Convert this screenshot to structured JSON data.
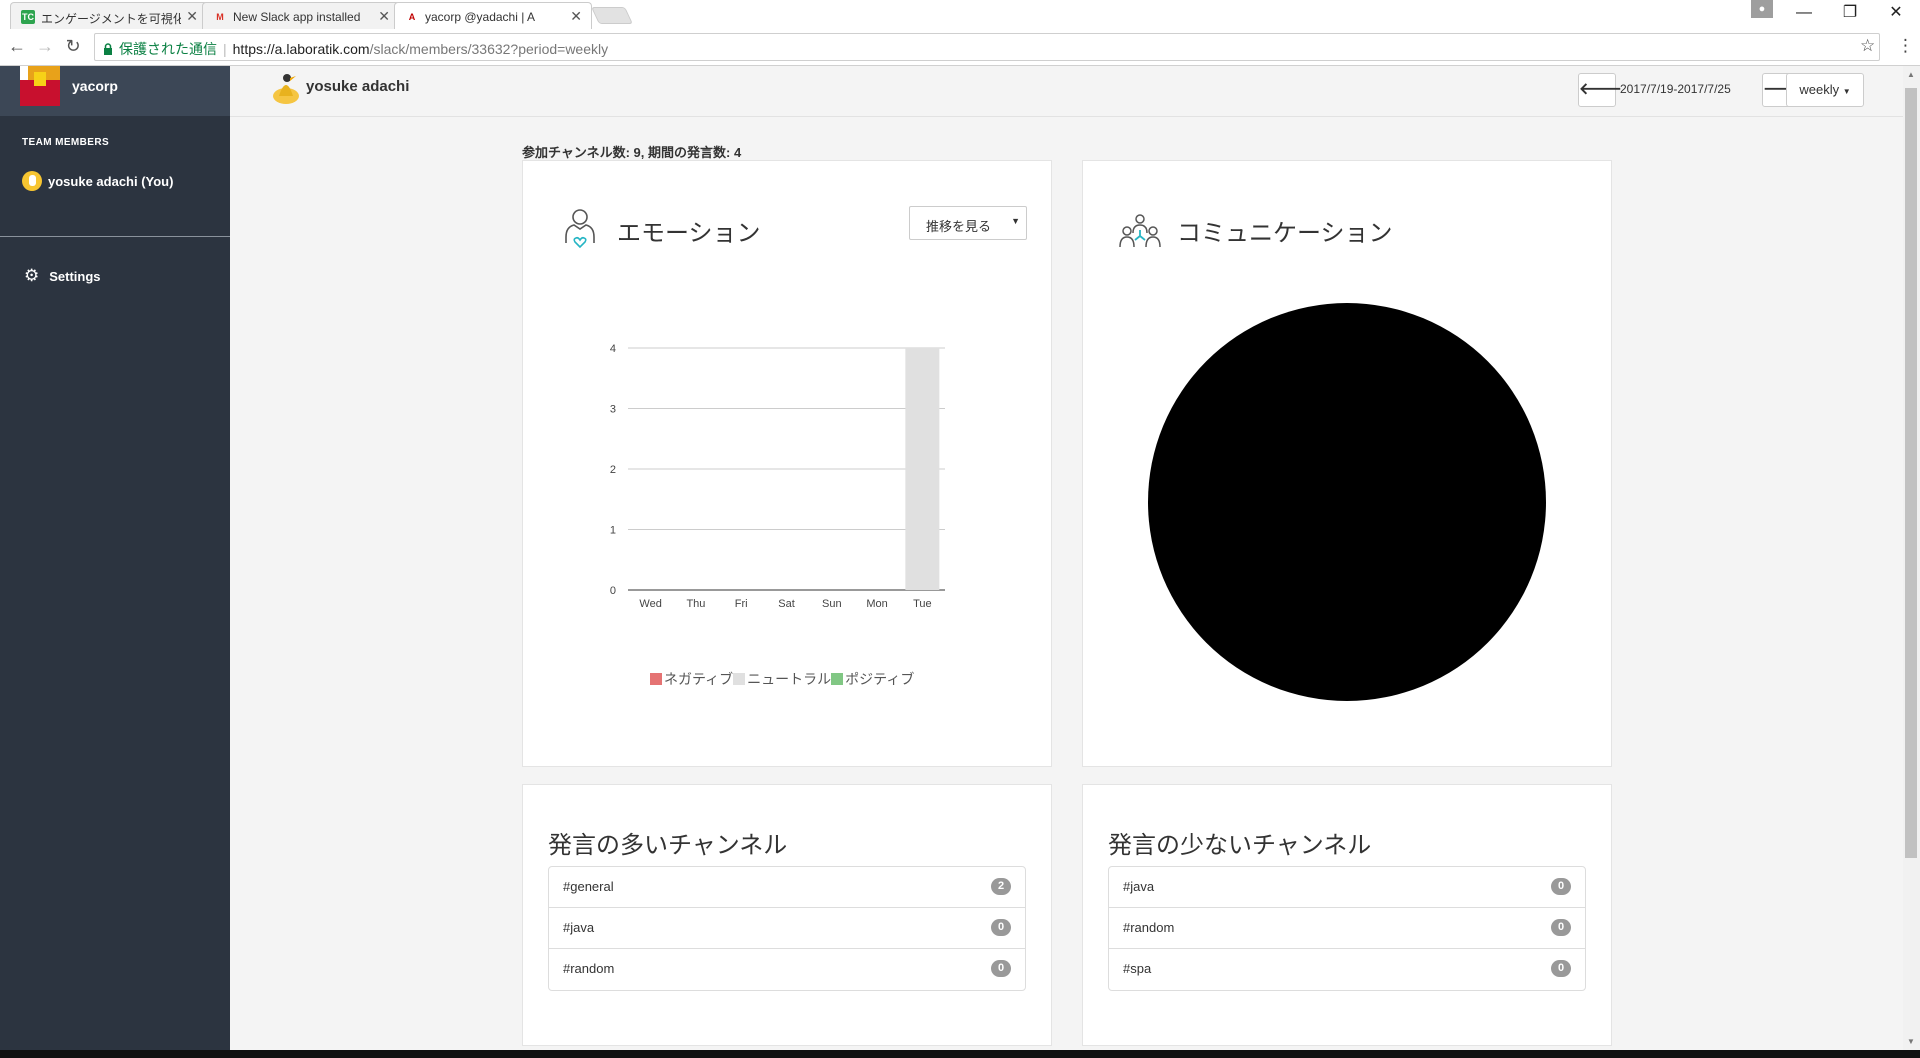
{
  "browser": {
    "tabs": [
      {
        "favicon": "TC",
        "favicon_color": "#2ea44f",
        "label": "エンゲージメントを可視化する"
      },
      {
        "favicon": "M",
        "favicon_color": "#d93025",
        "label": "New Slack app installed"
      },
      {
        "favicon": "A",
        "favicon_color": "#c00000",
        "label": "yacorp @yadachi | A"
      }
    ],
    "secure_label": "保護された通信",
    "url_host": "https://a.laboratik.com",
    "url_path": "/slack/members/33632?period=weekly"
  },
  "sidebar": {
    "team_name": "yacorp",
    "members_heading": "TEAM MEMBERS",
    "members": [
      {
        "name": "yosuke adachi (You)"
      }
    ],
    "settings_label": "Settings"
  },
  "header": {
    "user_name": "yosuke adachi",
    "period_range": "2017/7/19-2017/7/25",
    "period_select": "weekly"
  },
  "stats_line": "参加チャンネル数: 9, 期間の発言数: 4",
  "emotion_card": {
    "title": "エモーション",
    "trend_select": "推移を見る",
    "legend": [
      {
        "label": "ネガティブ",
        "color": "#e57373"
      },
      {
        "label": "ニュートラル",
        "color": "#e0e0e0"
      },
      {
        "label": "ポジティブ",
        "color": "#81c784"
      }
    ]
  },
  "communication_card": {
    "title": "コミュニケーション"
  },
  "chart_data": {
    "type": "bar",
    "stacked": true,
    "categories": [
      "Wed",
      "Thu",
      "Fri",
      "Sat",
      "Sun",
      "Mon",
      "Tue"
    ],
    "series": [
      {
        "name": "ネガティブ",
        "color": "#e57373",
        "values": [
          0,
          0,
          0,
          0,
          0,
          0,
          0
        ]
      },
      {
        "name": "ニュートラル",
        "color": "#e0e0e0",
        "values": [
          0,
          0,
          0,
          0,
          0,
          0,
          4
        ]
      },
      {
        "name": "ポジティブ",
        "color": "#81c784",
        "values": [
          0,
          0,
          0,
          0,
          0,
          0,
          0
        ]
      }
    ],
    "yticks": [
      0,
      1,
      2,
      3,
      4
    ],
    "ylim": [
      0,
      4
    ],
    "grid": true,
    "legend_position": "bottom"
  },
  "most_channels": {
    "title": "発言の多いチャンネル",
    "items": [
      {
        "name": "#general",
        "count": "2"
      },
      {
        "name": "#java",
        "count": "0"
      },
      {
        "name": "#random",
        "count": "0"
      }
    ]
  },
  "least_channels": {
    "title": "発言の少ないチャンネル",
    "items": [
      {
        "name": "#java",
        "count": "0"
      },
      {
        "name": "#random",
        "count": "0"
      },
      {
        "name": "#spa",
        "count": "0"
      }
    ]
  }
}
